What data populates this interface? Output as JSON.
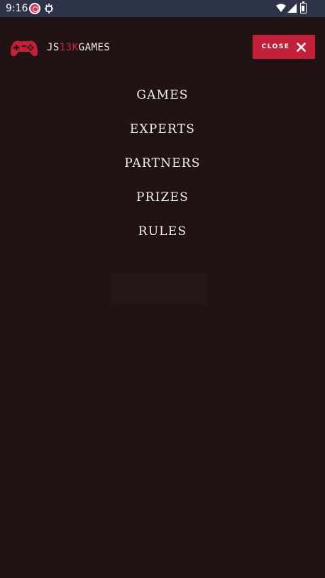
{
  "status_bar": {
    "time": "9:16",
    "icons": [
      "record-icon",
      "bug-icon",
      "wifi-icon",
      "signal-icon",
      "battery-icon"
    ]
  },
  "header": {
    "logo_icon": "gamepad-icon",
    "logo_prefix": "JS",
    "logo_accent": "13K",
    "logo_suffix": "GAMES",
    "close_label": "CLOSE",
    "close_icon": "close-icon"
  },
  "nav": {
    "items": [
      {
        "label": "GAMES"
      },
      {
        "label": "EXPERTS"
      },
      {
        "label": "PARTNERS"
      },
      {
        "label": "PRIZES"
      },
      {
        "label": "RULES"
      }
    ]
  },
  "colors": {
    "background": "#201314",
    "accent": "#c4203a",
    "status_bar": "#2f3348",
    "text": "#f3eeee"
  }
}
